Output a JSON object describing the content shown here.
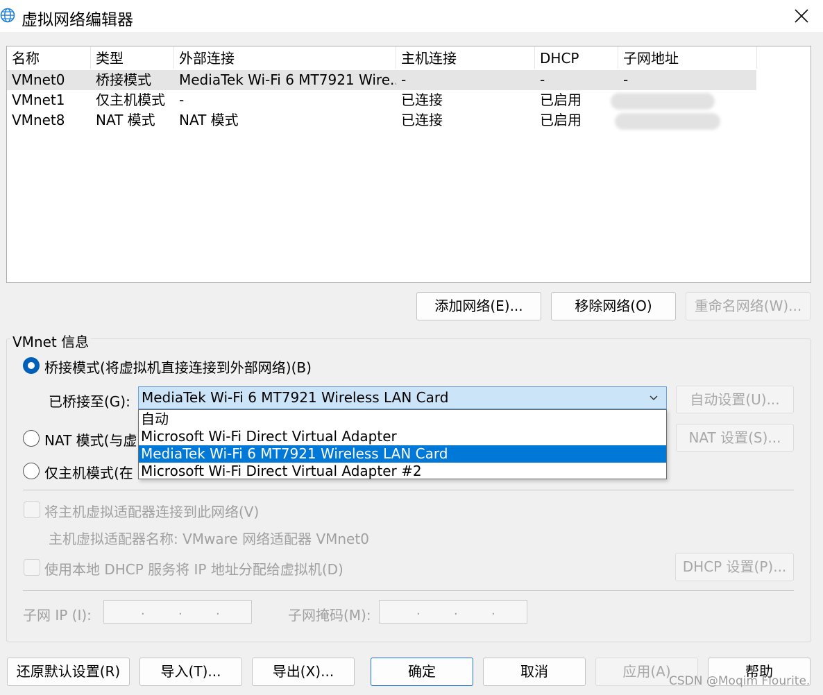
{
  "window": {
    "title": "虚拟网络编辑器",
    "icon": "globe-icon",
    "close_icon": "close-icon"
  },
  "network_table": {
    "headers": [
      "名称",
      "类型",
      "外部连接",
      "主机连接",
      "DHCP",
      "子网地址"
    ],
    "rows": [
      {
        "name": "VMnet0",
        "type": "桥接模式",
        "external": "MediaTek Wi-Fi 6 MT7921 Wire...",
        "host": "-",
        "dhcp": "-",
        "subnet": "-"
      },
      {
        "name": "VMnet1",
        "type": "仅主机模式",
        "external": "-",
        "host": "已连接",
        "dhcp": "已启用",
        "subnet": ""
      },
      {
        "name": "VMnet8",
        "type": "NAT 模式",
        "external": "NAT 模式",
        "host": "已连接",
        "dhcp": "已启用",
        "subnet": ""
      }
    ]
  },
  "table_buttons": {
    "add": "添加网络(E)...",
    "remove": "移除网络(O)",
    "rename": "重命名网络(W)..."
  },
  "vmnet_info": {
    "title": "VMnet 信息",
    "bridge_label": "桥接模式(将虚拟机直接连接到外部网络)(B)",
    "bridged_to_label": "已桥接至(G):",
    "bridged_to_value": "MediaTek Wi-Fi 6 MT7921 Wireless LAN Card",
    "dropdown_options": [
      "自动",
      "Microsoft Wi-Fi Direct Virtual Adapter",
      "MediaTek Wi-Fi 6 MT7921 Wireless LAN Card",
      "Microsoft Wi-Fi Direct Virtual Adapter #2"
    ],
    "auto_settings": "自动设置(U)...",
    "nat_label": "NAT 模式(与虚",
    "nat_settings": "NAT 设置(S)...",
    "hostonly_label": "仅主机模式(在",
    "connect_adapter_label": "将主机虚拟适配器连接到此网络(V)",
    "adapter_name_label": "主机虚拟适配器名称: VMware 网络适配器 VMnet0",
    "dhcp_label": "使用本地 DHCP 服务将 IP 地址分配给虚拟机(D)",
    "dhcp_settings": "DHCP 设置(P)...",
    "subnet_ip_label": "子网 IP (I):",
    "subnet_mask_label": "子网掩码(M):"
  },
  "footer_buttons": {
    "restore": "还原默认设置(R)",
    "import": "导入(T)...",
    "export": "导出(X)...",
    "ok": "确定",
    "cancel": "取消",
    "apply": "应用(A)",
    "help": "帮助"
  },
  "watermark": "CSDN @Moqim Flourite.",
  "colors": {
    "accent": "#005fb8",
    "selection": "#0078d7",
    "combo_bg": "#cce4f7"
  }
}
